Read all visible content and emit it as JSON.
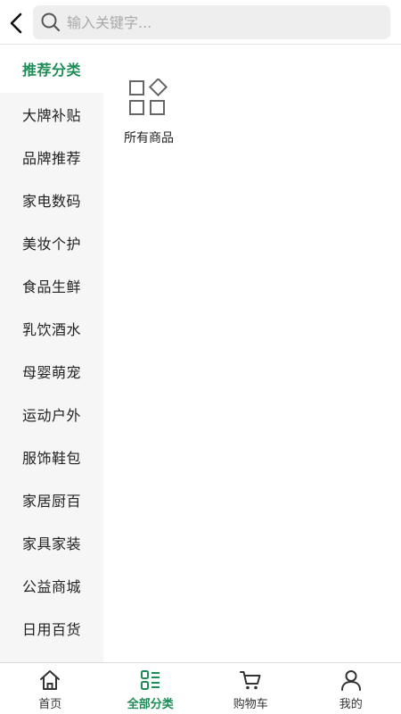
{
  "header": {
    "search_placeholder": "输入关键字..."
  },
  "sidebar": {
    "items": [
      {
        "label": "推荐分类",
        "active": true
      },
      {
        "label": "大牌补贴"
      },
      {
        "label": "品牌推荐"
      },
      {
        "label": "家电数码"
      },
      {
        "label": "美妆个护"
      },
      {
        "label": "食品生鲜"
      },
      {
        "label": "乳饮酒水"
      },
      {
        "label": "母婴萌宠"
      },
      {
        "label": "运动户外"
      },
      {
        "label": "服饰鞋包"
      },
      {
        "label": "家居厨百"
      },
      {
        "label": "家具家装"
      },
      {
        "label": "公益商城"
      },
      {
        "label": "日用百货"
      }
    ]
  },
  "content": {
    "items": [
      {
        "label": "所有商品",
        "icon": "all-products-icon"
      }
    ]
  },
  "tabbar": {
    "items": [
      {
        "label": "首页",
        "icon": "home-icon"
      },
      {
        "label": "全部分类",
        "icon": "category-list-icon",
        "active": true
      },
      {
        "label": "购物车",
        "icon": "cart-icon"
      },
      {
        "label": "我的",
        "icon": "user-icon"
      }
    ]
  },
  "colors": {
    "accent": "#1e8c57",
    "sidebar_bg": "#f6f6f6",
    "search_bg": "#eeeeee"
  }
}
